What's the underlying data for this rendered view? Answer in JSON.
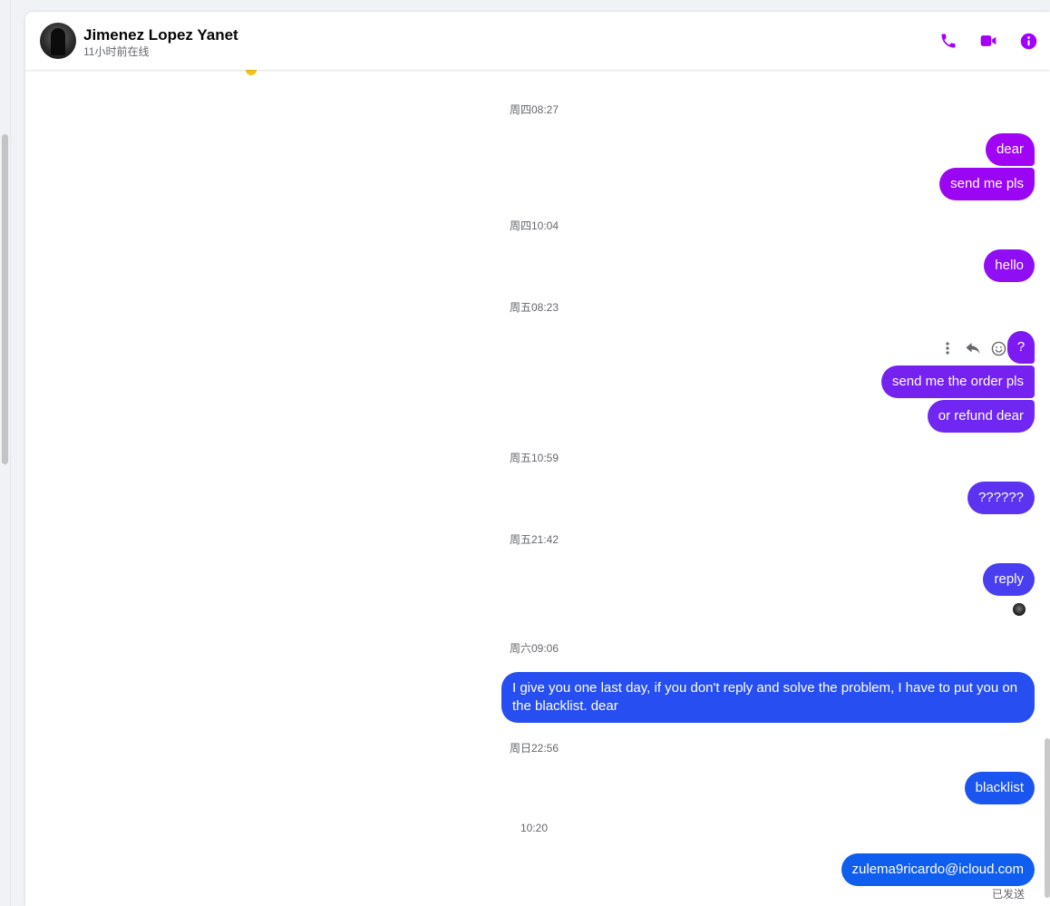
{
  "contact": {
    "name": "Jimenez Lopez Yanet",
    "status": "11小时前在线"
  },
  "header_icons": [
    "phone-icon",
    "video-icon",
    "info-icon"
  ],
  "accent_color": "#a100ff",
  "messages": {
    "ts1": "周四08:27",
    "m_dear": "dear",
    "m_send_pls": "send me pls",
    "ts2": "周四10:04",
    "m_hello": "hello",
    "ts3": "周五08:23",
    "m_question": "?",
    "m_order": "send me the order pls",
    "m_refund": "or refund dear",
    "ts4": "周五10:59",
    "m_qqq": "??????",
    "ts5": "周五21:42",
    "m_reply": "reply",
    "ts6": "周六09:06",
    "m_blacklist_warning": "I give you one last day, if you don't reply and solve the problem, I have to put you on the blacklist. dear",
    "ts7": "周日22:56",
    "m_blacklist": "blacklist",
    "ts8": "10:20",
    "m_email": "zulema9ricardo@icloud.com",
    "sent_status": "已发送"
  },
  "message_actions": [
    "more-icon",
    "reply-icon",
    "emoji-icon"
  ]
}
